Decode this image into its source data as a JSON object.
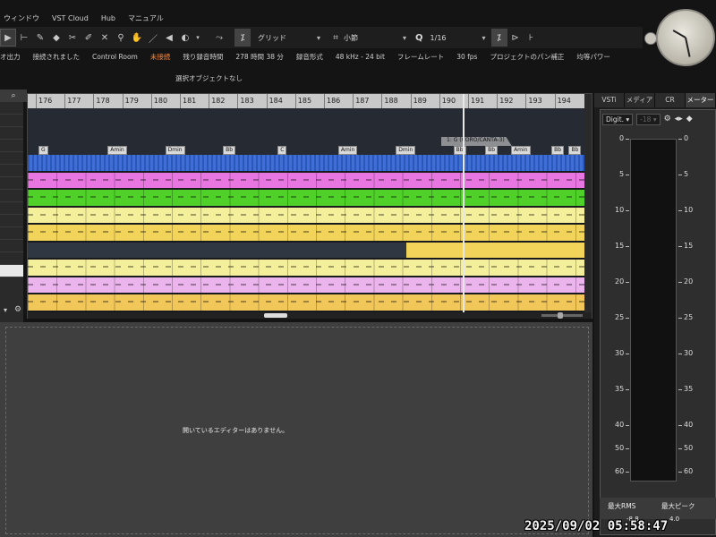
{
  "menu": [
    "ウィンドウ",
    "VST Cloud",
    "Hub",
    "マニュアル"
  ],
  "toolbar": {
    "snap_type": "グリッド",
    "grid_type": "小節",
    "quantize_label": "Q",
    "quantize_value": "1/16"
  },
  "status": [
    {
      "text": "オ出力",
      "warn": false
    },
    {
      "text": "接続されました",
      "warn": false
    },
    {
      "text": "Control Room",
      "warn": false
    },
    {
      "text": "未接続",
      "warn": true
    },
    {
      "text": "残り録音時間",
      "warn": false
    },
    {
      "text": "278 時間 38 分",
      "warn": false
    },
    {
      "text": "録音形式",
      "warn": false
    },
    {
      "text": "48 kHz - 24 bit",
      "warn": false
    },
    {
      "text": "フレームレート",
      "warn": false
    },
    {
      "text": "30 fps",
      "warn": false
    },
    {
      "text": "プロジェクトのパン補正",
      "warn": false
    },
    {
      "text": "均等パワー",
      "warn": false
    }
  ],
  "selection_info": "選択オブジェクトなし",
  "ruler": [
    "176",
    "177",
    "178",
    "179",
    "180",
    "181",
    "182",
    "183",
    "184",
    "185",
    "186",
    "187",
    "188",
    "189",
    "190",
    "191",
    "192",
    "193",
    "194"
  ],
  "chords": [
    {
      "label": "G",
      "bar": 0
    },
    {
      "label": "Amin",
      "bar": 2.4
    },
    {
      "label": "Dmin",
      "bar": 4.4
    },
    {
      "label": "Bb",
      "bar": 6.4
    },
    {
      "label": "C",
      "bar": 8.3
    },
    {
      "label": "Amin",
      "bar": 10.4
    },
    {
      "label": "Dmin",
      "bar": 12.4
    },
    {
      "label": "Bb",
      "bar": 14.4
    },
    {
      "label": "Bb",
      "bar": 15.5
    },
    {
      "label": "Amin",
      "bar": 16.4
    },
    {
      "label": "Bb",
      "bar": 17.8
    },
    {
      "label": "Bb",
      "bar": 18.4
    }
  ],
  "marker": "1: G (CORO/CANTA-3)",
  "tracks": [
    {
      "color": "#3f6fd6",
      "kind": "audio"
    },
    {
      "color": "#e876e0",
      "kind": "midi"
    },
    {
      "color": "#4fd12a",
      "kind": "midi"
    },
    {
      "color": "#f4ef9a",
      "kind": "midi"
    },
    {
      "color": "#f3d45a",
      "kind": "midi"
    },
    {
      "color": "#f3d45a",
      "kind": "partial"
    },
    {
      "color": "#f4ef9a",
      "kind": "midi"
    },
    {
      "color": "#ecb4ec",
      "kind": "midi"
    },
    {
      "color": "#f2c75a",
      "kind": "midi"
    }
  ],
  "editor_message": "開いているエディターはありません。",
  "right_tabs": [
    {
      "label": "VSTi",
      "active": false
    },
    {
      "label": "メディア",
      "active": false
    },
    {
      "label": "CR",
      "active": false
    },
    {
      "label": "メーター",
      "active": true
    }
  ],
  "meter": {
    "mode": "Digit.",
    "reference": "-18",
    "scale": [
      "0",
      "5",
      "10",
      "15",
      "20",
      "25",
      "30",
      "35",
      "40",
      "50",
      "60"
    ],
    "max_rms_label": "最大RMS",
    "max_peak_label": "最大ピーク",
    "max_rms_value": "-8.8",
    "max_peak_value": "4.0"
  },
  "timestamp": "2025/09/02  05:58:47"
}
